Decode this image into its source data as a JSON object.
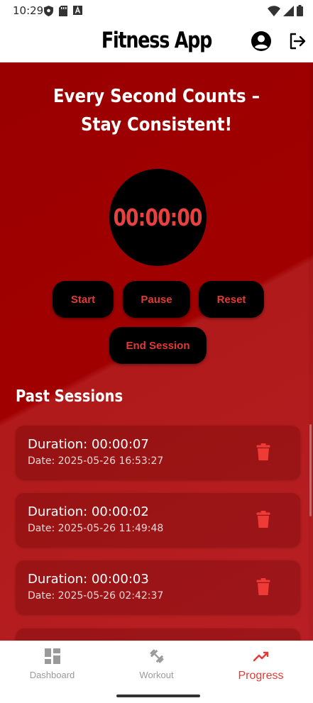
{
  "status_bar": {
    "time": "10:29"
  },
  "app_bar": {
    "title": "Fitness App"
  },
  "headline": "Every Second Counts – Stay Consistent!",
  "timer": {
    "display": "00:00:00"
  },
  "controls": {
    "start_label": "Start",
    "pause_label": "Pause",
    "reset_label": "Reset",
    "end_label": "End Session"
  },
  "past_sessions": {
    "title": "Past Sessions",
    "items": [
      {
        "duration": "Duration: 00:00:07",
        "date": "Date: 2025-05-26 16:53:27"
      },
      {
        "duration": "Duration: 00:00:02",
        "date": "Date: 2025-05-26 11:49:48"
      },
      {
        "duration": "Duration: 00:00:03",
        "date": "Date: 2025-05-26 02:42:37"
      }
    ]
  },
  "bottom_nav": {
    "items": [
      {
        "label": "Dashboard",
        "icon": "dashboard-icon",
        "active": false
      },
      {
        "label": "Workout",
        "icon": "dumbbell-icon",
        "active": false
      },
      {
        "label": "Progress",
        "icon": "trending-up-icon",
        "active": true
      }
    ]
  },
  "colors": {
    "accent": "#e53935",
    "background_red": "#a10000",
    "timer_text": "#e8413f",
    "button_bg": "#000000"
  }
}
